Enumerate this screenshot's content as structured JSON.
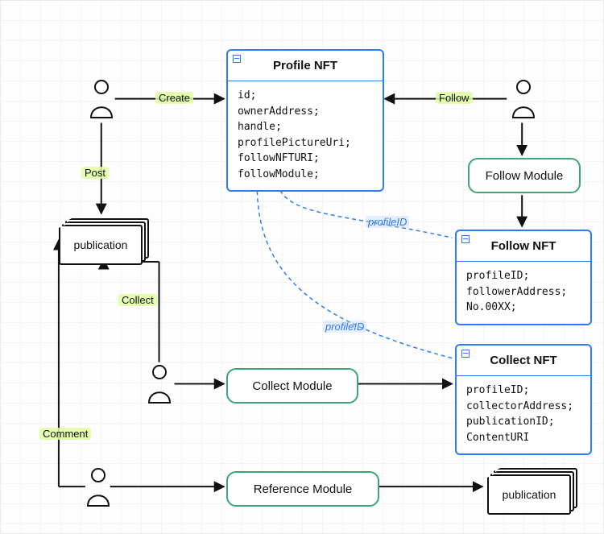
{
  "cards": {
    "profile": {
      "title": "Profile NFT",
      "fields": [
        "id;",
        "ownerAddress;",
        "handle;",
        "profilePictureUri;",
        "followNFTURI;",
        "followModule;"
      ]
    },
    "followNft": {
      "title": "Follow NFT",
      "fields": [
        "profileID;",
        "followerAddress;",
        "No.00XX;"
      ]
    },
    "collectNft": {
      "title": "Collect NFT",
      "fields": [
        "profileID;",
        "collectorAddress;",
        "publicationID;",
        "ContentURI"
      ]
    }
  },
  "modules": {
    "follow": "Follow Module",
    "collect": "Collect Module",
    "reference": "Reference Module"
  },
  "publications": {
    "pub1": "publication",
    "pub2": "publication"
  },
  "edges": {
    "create": "Create",
    "follow": "Follow",
    "post": "Post",
    "collect": "Collect",
    "comment": "Comment"
  },
  "links": {
    "toFollow": "profileID",
    "toCollect": "profileID"
  }
}
